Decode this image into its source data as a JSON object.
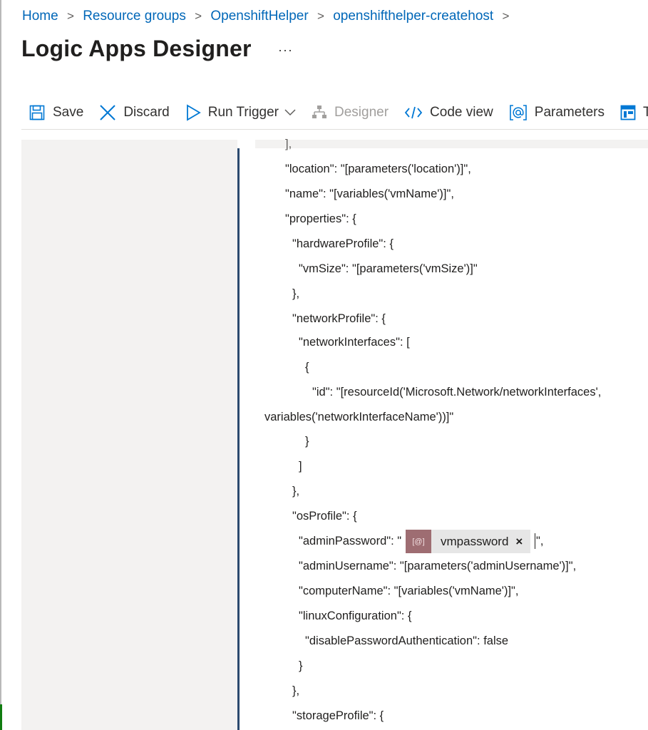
{
  "breadcrumb": [
    {
      "label": "Home"
    },
    {
      "label": "Resource groups"
    },
    {
      "label": "OpenshiftHelper"
    },
    {
      "label": "openshifthelper-createhost"
    }
  ],
  "breadcrumb_separator": ">",
  "page": {
    "title": "Logic Apps Designer",
    "more_label": "···"
  },
  "toolbar": {
    "save": "Save",
    "discard": "Discard",
    "run_trigger": "Run Trigger",
    "designer": "Designer",
    "code_view": "Code view",
    "parameters": "Parameters",
    "templates_partial": "T"
  },
  "code": {
    "lines": [
      "],",
      "\"location\": \"[parameters('location')]\",",
      "\"name\": \"[variables('vmName')]\",",
      "\"properties\": {",
      "\"hardwareProfile\": {",
      "\"vmSize\": \"[parameters('vmSize')]\"",
      "},",
      "\"networkProfile\": {",
      "\"networkInterfaces\": [",
      "{",
      "\"id\": \"[resourceId('Microsoft.Network/networkInterfaces',",
      "variables('networkInterfaceName'))]\"",
      "}",
      "]",
      "},",
      "\"osProfile\": {",
      "\"adminPassword\": \"",
      "\"adminUsername\": \"[parameters('adminUsername')]\",",
      "\"computerName\": \"[variables('vmName')]\",",
      "\"linuxConfiguration\": {",
      "\"disablePasswordAuthentication\": false",
      "}",
      "},",
      "\"storageProfile\": {"
    ],
    "admin_password_suffix": "\",",
    "token": {
      "icon_label": "[@]",
      "label": "vmpassword",
      "close": "×"
    }
  },
  "colors": {
    "link": "#0067b8",
    "accent": "#0078d4",
    "token_icon_bg": "#9e6d72",
    "editor_border": "#2b4a6f"
  }
}
